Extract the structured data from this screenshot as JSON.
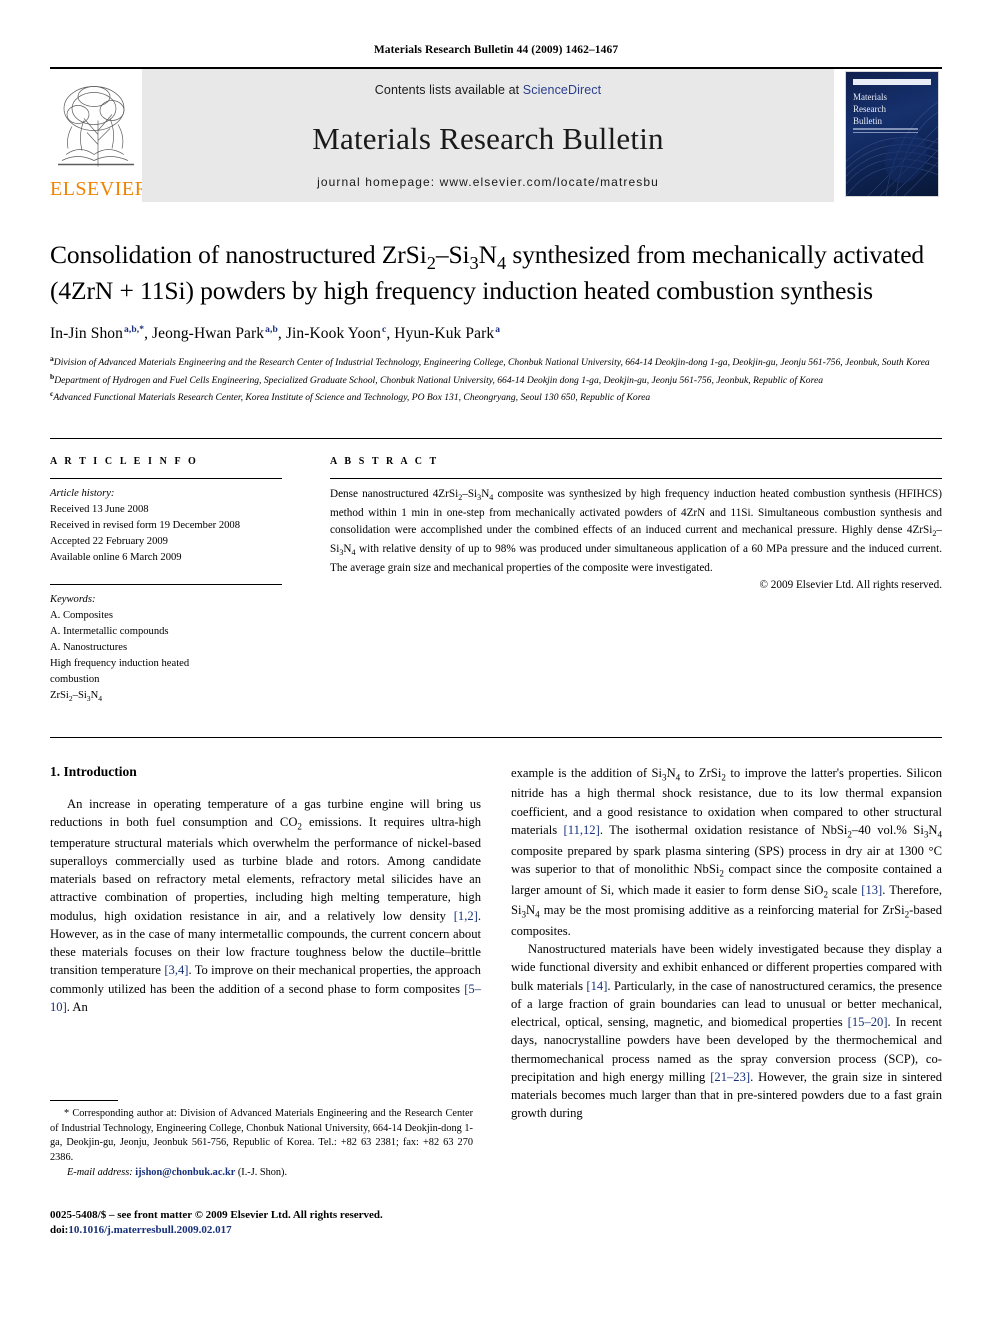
{
  "running_head": "Materials Research Bulletin 44 (2009) 1462–1467",
  "masthead": {
    "publisher_name": "ELSEVIER",
    "contents_prefix": "Contents lists available at ",
    "contents_link": "ScienceDirect",
    "journal_title": "Materials Research Bulletin",
    "homepage": "journal homepage: www.elsevier.com/locate/matresbu",
    "cover_title_line1": "Materials",
    "cover_title_line2": "Research",
    "cover_title_line3": "Bulletin",
    "link_color": "#2b3f8c",
    "band_color": "#e8e8e8",
    "elsevier_orange": "#ef8200"
  },
  "article": {
    "title_part1": "Consolidation of nanostructured ZrSi",
    "title_sub1": "2",
    "title_part2": "–Si",
    "title_sub2": "3",
    "title_part3": "N",
    "title_sub3": "4",
    "title_part4": " synthesized from mechanically activated (4ZrN + 11Si) powders by high frequency induction heated combustion synthesis",
    "authors": [
      {
        "name": "In-Jin Shon",
        "marks": "a,b,*"
      },
      {
        "name": "Jeong-Hwan Park",
        "marks": "a,b"
      },
      {
        "name": "Jin-Kook Yoon",
        "marks": "c"
      },
      {
        "name": "Hyun-Kuk Park",
        "marks": "a"
      }
    ],
    "affiliations": [
      {
        "mark": "a",
        "text": "Division of Advanced Materials Engineering and the Research Center of Industrial Technology, Engineering College, Chonbuk National University, 664-14 Deokjin-dong 1-ga, Deokjin-gu, Jeonju 561-756, Jeonbuk, South Korea"
      },
      {
        "mark": "b",
        "text": "Department of Hydrogen and Fuel Cells Engineering, Specialized Graduate School, Chonbuk National University, 664-14 Deokjin dong 1-ga, Deokjin-gu, Jeonju 561-756, Jeonbuk, Republic of Korea"
      },
      {
        "mark": "c",
        "text": "Advanced Functional Materials Research Center, Korea Institute of Science and Technology, PO Box 131, Cheongryang, Seoul 130 650, Republic of Korea"
      }
    ]
  },
  "article_info": {
    "heading": "A R T I C L E  I N F O",
    "history_label": "Article history:",
    "history": [
      "Received 13 June 2008",
      "Received in revised form 19 December 2008",
      "Accepted 22 February 2009",
      "Available online 6 March 2009"
    ],
    "keywords_label": "Keywords:",
    "keywords": [
      "A. Composites",
      "A. Intermetallic compounds",
      "A. Nanostructures",
      "High frequency induction heated",
      "combustion"
    ],
    "keyword_formula": "ZrSi2–Si3N4"
  },
  "abstract": {
    "heading": "A B S T R A C T",
    "text": "Dense nanostructured 4ZrSi2–Si3N4 composite was synthesized by high frequency induction heated combustion synthesis (HFIHCS) method within 1 min in one-step from mechanically activated powders of 4ZrN and 11Si. Simultaneous combustion synthesis and consolidation were accomplished under the combined effects of an induced current and mechanical pressure. Highly dense 4ZrSi2–Si3N4 with relative density of up to 98% was produced under simultaneous application of a 60 MPa pressure and the induced current. The average grain size and mechanical properties of the composite were investigated.",
    "copyright": "© 2009 Elsevier Ltd. All rights reserved."
  },
  "body": {
    "section_heading": "1. Introduction",
    "left_paragraph": "An increase in operating temperature of a gas turbine engine will bring us reductions in both fuel consumption and CO2 emissions. It requires ultra-high temperature structural materials which overwhelm the performance of nickel-based superalloys commercially used as turbine blade and rotors. Among candidate materials based on refractory metal elements, refractory metal silicides have an attractive combination of properties, including high melting temperature, high modulus, high oxidation resistance in air, and a relatively low density [1,2]. However, as in the case of many intermetallic compounds, the current concern about these materials focuses on their low fracture toughness below the ductile–brittle transition temperature [3,4]. To improve on their mechanical properties, the approach commonly utilized has been the addition of a second phase to form composites [5–10]. An",
    "right_paragraph_1": "example is the addition of Si3N4 to ZrSi2 to improve the latter's properties. Silicon nitride has a high thermal shock resistance, due to its low thermal expansion coefficient, and a good resistance to oxidation when compared to other structural materials [11,12]. The isothermal oxidation resistance of NbSi2–40 vol.% Si3N4 composite prepared by spark plasma sintering (SPS) process in dry air at 1300 °C was superior to that of monolithic NbSi2 compact since the composite contained a larger amount of Si, which made it easier to form dense SiO2 scale [13]. Therefore, Si3N4 may be the most promising additive as a reinforcing material for ZrSi2-based composites.",
    "right_paragraph_2": "Nanostructured materials have been widely investigated because they display a wide functional diversity and exhibit enhanced or different properties compared with bulk materials [14]. Particularly, in the case of nanostructured ceramics, the presence of a large fraction of grain boundaries can lead to unusual or better mechanical, electrical, optical, sensing, magnetic, and biomedical properties [15–20]. In recent days, nanocrystalline powders have been developed by the thermochemical and thermomechanical process named as the spray conversion process (SCP), co-precipitation and high energy milling [21–23]. However, the grain size in sintered materials becomes much larger than that in pre-sintered powders due to a fast grain growth during"
  },
  "footnote": {
    "marker": "*",
    "text": "Corresponding author at: Division of Advanced Materials Engineering and the Research Center of Industrial Technology, Engineering College, Chonbuk National University, 664-14 Deokjin-dong 1-ga, Deokjin-gu, Jeonju, Jeonbuk 561-756, Republic of Korea. Tel.: +82 63 2381; fax: +82 63 270 2386.",
    "email_label": "E-mail address:",
    "email_address": "ijshon@chonbuk.ac.kr",
    "email_suffix": "(I.-J. Shon)."
  },
  "page_footer": {
    "front_matter": "0025-5408/$ – see front matter © 2009 Elsevier Ltd. All rights reserved.",
    "doi_prefix": "doi:",
    "doi_value": "10.1016/j.materresbull.2009.02.017"
  }
}
